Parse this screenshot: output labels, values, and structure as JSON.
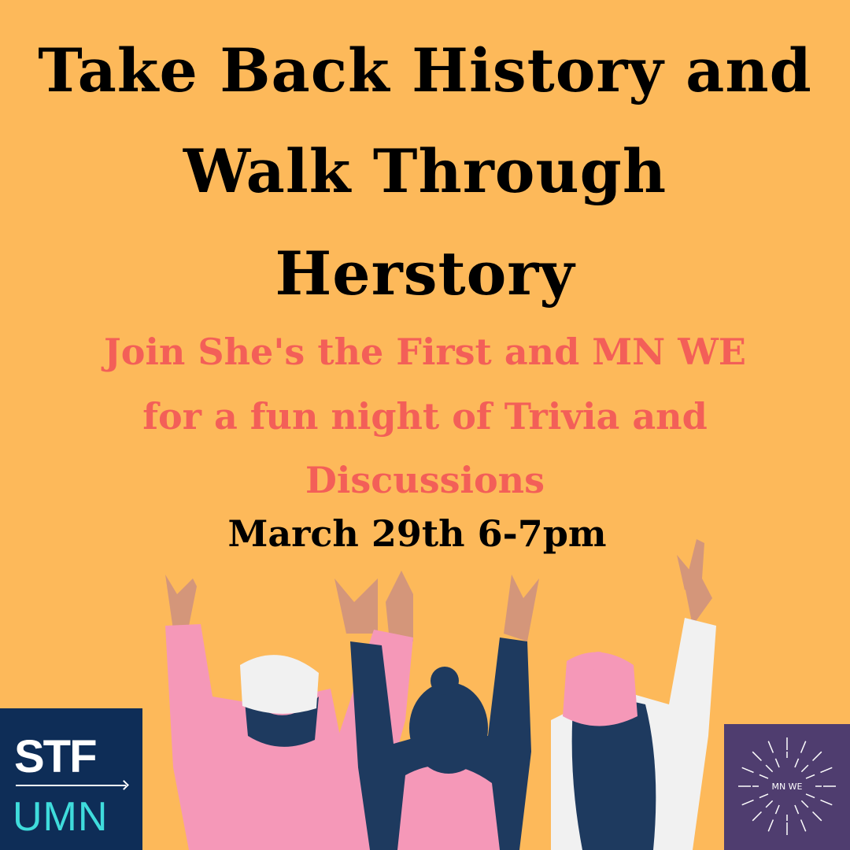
{
  "title_lines": [
    "Take Back History and",
    "Walk Through",
    "Herstory"
  ],
  "subtitle_lines": [
    "Join She's the First and MN WE",
    "for a fun night of Trivia and",
    "Discussions"
  ],
  "date": "March 29th 6-7pm",
  "logos": {
    "stf": {
      "top": "STF",
      "bottom": "UMN"
    },
    "mnwe": {
      "text": "MN WE"
    }
  },
  "colors": {
    "background": "#fdb95a",
    "subtitle": "#f35f58",
    "stf_bg": "#0e2d57",
    "mnwe_bg": "#4f3d6f"
  }
}
